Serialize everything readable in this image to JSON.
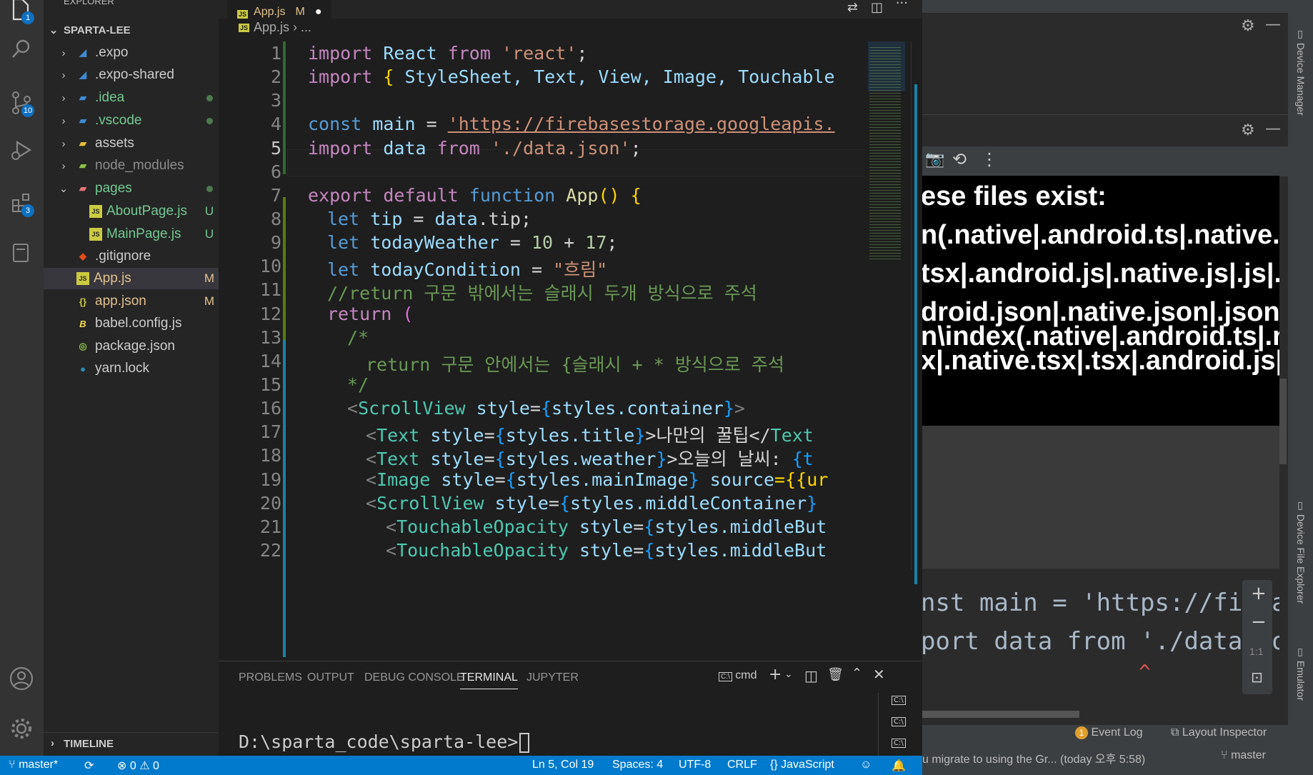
{
  "sidebar": {
    "header": "EXPLORER",
    "root": "SPARTA-LEE",
    "items": [
      {
        "label": ".expo",
        "status": ""
      },
      {
        "label": ".expo-shared",
        "status": ""
      },
      {
        "label": ".idea",
        "status": ""
      },
      {
        "label": ".vscode",
        "status": ""
      },
      {
        "label": "assets",
        "status": ""
      },
      {
        "label": "node_modules",
        "status": ""
      },
      {
        "label": "pages",
        "status": ""
      },
      {
        "label": "AboutPage.js",
        "status": "U"
      },
      {
        "label": "MainPage.js",
        "status": "U"
      },
      {
        "label": ".gitignore",
        "status": ""
      },
      {
        "label": "App.js",
        "status": "M"
      },
      {
        "label": "app.json",
        "status": "M"
      },
      {
        "label": "babel.config.js",
        "status": ""
      },
      {
        "label": "package.json",
        "status": ""
      },
      {
        "label": "yarn.lock",
        "status": ""
      }
    ],
    "timeline": "TIMELINE"
  },
  "activity": {
    "badges": {
      "explorer": "1",
      "scm": "10",
      "extensions": "3"
    }
  },
  "editor": {
    "tab": "App.js",
    "tab_status": "M",
    "breadcrumb": "App.js",
    "breadcrumb_more": "...",
    "line_numbers": [
      "1",
      "2",
      "3",
      "4",
      "5",
      "6",
      "7",
      "8",
      "9",
      "10",
      "11",
      "12",
      "13",
      "14",
      "15",
      "16",
      "17",
      "18",
      "19",
      "20",
      "21",
      "22"
    ],
    "code": {
      "l1": {
        "a": "import",
        "b": "React",
        "c": "from",
        "d": "'react'",
        "e": ";"
      },
      "l2": {
        "a": "import",
        "b": "{",
        "c": " StyleSheet, Text, View, Image, Touchable"
      },
      "l4": {
        "a": "const",
        "b": "main",
        "c": " = ",
        "d": "'https://firebasestorage.googleapis."
      },
      "l5": {
        "a": "import",
        "b": "data",
        "c": "from",
        "d": "'./data.json'",
        "e": ";"
      },
      "l7": {
        "a": "export",
        "b": "default",
        "c": "function",
        "d": "App",
        "e": "()",
        "f": "{"
      },
      "l8": {
        "a": "let",
        "b": "tip",
        "c": " = ",
        "d": "data",
        "e": ".tip;"
      },
      "l9": {
        "a": "let",
        "b": "todayWeather",
        "c": " = ",
        "d": "10",
        "e": " + ",
        "f": "17",
        "g": ";"
      },
      "l10": {
        "a": "let",
        "b": "todayCondition",
        "c": " = ",
        "d": "\"흐림\""
      },
      "l11": {
        "a": "//return 구문 밖에서는 슬래시 두개 방식으로 주석"
      },
      "l12": {
        "a": "return",
        "b": "("
      },
      "l13": {
        "a": "/*"
      },
      "l14": {
        "a": "return 구문 안에서는 {슬래시 + * 방식으로 주석"
      },
      "l15": {
        "a": "*/"
      },
      "l16": {
        "a": "<",
        "b": "ScrollView",
        "c": "style",
        "d": "=",
        "e": "{",
        "f": "styles",
        "g": ".container",
        "h": "}",
        "i": ">"
      },
      "l17": {
        "a": "<",
        "b": "Text",
        "c": "style",
        "d": "=",
        "e": "{",
        "f": "styles",
        "g": ".title",
        "h": "}",
        "i": ">나만의 꿀팁</",
        "j": "Text"
      },
      "l18": {
        "a": "<",
        "b": "Text",
        "c": "style",
        "d": "=",
        "e": "{",
        "f": "styles",
        "g": ".weather",
        "h": "}",
        "i": ">오늘의 날씨: ",
        "j": "{t"
      },
      "l19": {
        "a": "<",
        "b": "Image",
        "c": "style",
        "d": "=",
        "e": "{",
        "f": "styles",
        "g": ".mainImage",
        "h": "}",
        "i": "source",
        "j": "={{ur"
      },
      "l20": {
        "a": "<",
        "b": "ScrollView",
        "c": "style",
        "d": "=",
        "e": "{",
        "f": "styles",
        "g": ".middleContainer",
        "h": "}"
      },
      "l21": {
        "a": "<",
        "b": "TouchableOpacity",
        "c": "style",
        "d": "=",
        "e": "{",
        "f": "styles",
        "g": ".middleBut"
      },
      "l22": {
        "a": "<",
        "b": "TouchableOpacity",
        "c": "style",
        "d": "=",
        "e": "{",
        "f": "styles",
        "g": ".middleBut"
      }
    }
  },
  "panel": {
    "tabs": [
      "PROBLEMS",
      "OUTPUT",
      "DEBUG CONSOLE",
      "TERMINAL",
      "JUPYTER"
    ],
    "active_tab": "TERMINAL",
    "shell": "cmd",
    "prompt": "D:\\sparta_code\\sparta-lee>"
  },
  "status": {
    "branch": "master*",
    "errors": "0",
    "warnings": "0",
    "position": "Ln 5, Col 19",
    "spaces": "Spaces: 4",
    "encoding": "UTF-8",
    "eol": "CRLF",
    "language": "JavaScript"
  },
  "right_pane": {
    "emulator_lines": [
      "ese files exist:",
      "n(.native|.android.ts|.native.ts|",
      "tsx|.android.js|.native.js|.js|.ar",
      "droid.json|.native.json|.json)",
      "n\\index(.native|.android.ts|.na",
      "x|.native.tsx|.tsx|.android.js|.n"
    ],
    "code_lines": [
      "nst main = 'https://fir as",
      "port data from './data. on"
    ],
    "caret": "^",
    "side_labels": [
      "Device Manager",
      "Device File Explorer",
      "Emulator"
    ],
    "zoom_label": "1:1",
    "event_log": "Event Log",
    "event_log_count": "1",
    "layout_inspector": "Layout Inspector",
    "message": "u migrate to using the Gr... (today 오후 5:58)",
    "branch": "master"
  }
}
